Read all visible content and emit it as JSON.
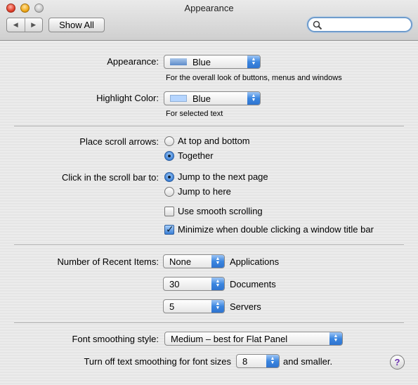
{
  "window": {
    "title": "Appearance"
  },
  "toolbar": {
    "back_icon": "back-arrow-icon",
    "forward_icon": "forward-arrow-icon",
    "show_all_label": "Show All",
    "search_placeholder": ""
  },
  "appearance": {
    "label": "Appearance:",
    "value": "Blue",
    "swatch_color": "#7fa6d8",
    "note": "For the overall look of buttons, menus and windows"
  },
  "highlight": {
    "label": "Highlight Color:",
    "value": "Blue",
    "swatch_color": "#b5d5ff",
    "note": "For selected text"
  },
  "scroll_arrows": {
    "label": "Place scroll arrows:",
    "options": [
      "At top and bottom",
      "Together"
    ],
    "selected": "Together"
  },
  "scroll_bar": {
    "label": "Click in the scroll bar to:",
    "options": [
      "Jump to the next page",
      "Jump to here"
    ],
    "selected": "Jump to the next page"
  },
  "checkboxes": {
    "smooth_scrolling": {
      "label": "Use smooth scrolling",
      "checked": false
    },
    "minimize_dblclick": {
      "label": "Minimize when double clicking a window title bar",
      "checked": true
    }
  },
  "recent_items": {
    "label": "Number of Recent Items:",
    "applications": {
      "value": "None",
      "label": "Applications"
    },
    "documents": {
      "value": "30",
      "label": "Documents"
    },
    "servers": {
      "value": "5",
      "label": "Servers"
    }
  },
  "font_smoothing": {
    "label": "Font smoothing style:",
    "value": "Medium – best for Flat Panel"
  },
  "text_smoothing": {
    "label": "Turn off text smoothing for font sizes",
    "value": "8",
    "suffix": "and smaller."
  },
  "help": {
    "label": "?"
  },
  "colors": {
    "accent": "#3b86e0",
    "window_bg": "#ececec"
  }
}
